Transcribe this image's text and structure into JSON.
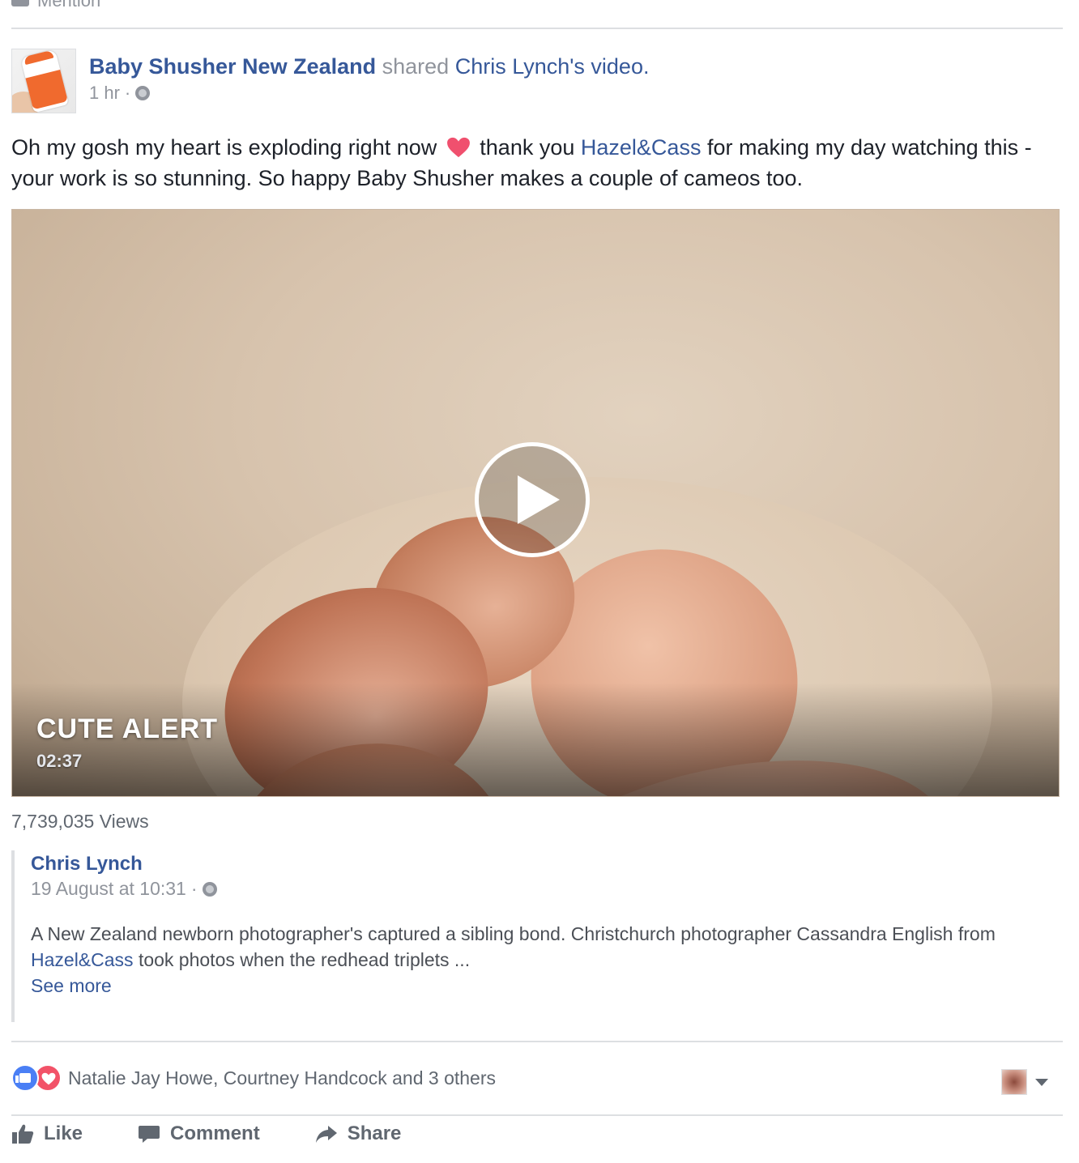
{
  "top": {
    "mention_label": "Mention"
  },
  "post": {
    "page_name": "Baby Shusher New Zealand",
    "shared_word": "shared",
    "shared_author": "Chris Lynch",
    "shared_suffix": "'s video.",
    "time": "1 hr",
    "text_part1": "Oh my gosh my heart is exploding right now",
    "text_part2": "thank you",
    "text_mention": "Hazel&Cass",
    "text_part3": "for making my day watching this - your work is so stunning. So happy Baby Shusher makes a couple of cameos too."
  },
  "video": {
    "title": "CUTE ALERT",
    "duration": "02:37",
    "views": "7,739,035 Views"
  },
  "shared": {
    "author": "Chris Lynch",
    "date": "19 August at 10:31",
    "text_part1": "A New Zealand newborn photographer's captured a sibling bond. Christchurch photographer Cassandra English from",
    "text_mention": "Hazel&Cass",
    "text_part2": "took photos when the redhead triplets ...",
    "see_more": "See more"
  },
  "reactions": {
    "summary": "Natalie Jay Howe, Courtney Handcock and 3 others"
  },
  "actions": {
    "like": "Like",
    "comment": "Comment",
    "share": "Share"
  },
  "colors": {
    "link": "#365899",
    "muted": "#90949c",
    "like_blue": "#4a7ff5",
    "love_red": "#f25268"
  }
}
